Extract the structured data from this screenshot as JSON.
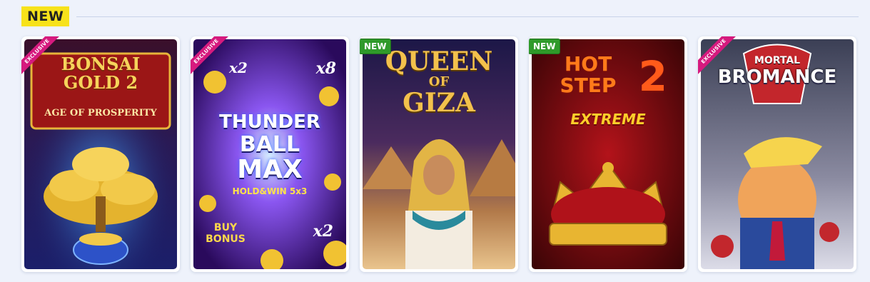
{
  "section": {
    "title": "NEW"
  },
  "games": [
    {
      "title_lines": [
        "BONSAI",
        "GOLD 2"
      ],
      "subtitle": "AGE OF PROSPERITY",
      "tag": "EXCLUSIVE"
    },
    {
      "badges": [
        "x2",
        "x8"
      ],
      "title_lines": [
        "THUNDER",
        "BALL",
        "MAX"
      ],
      "subtitle": "HOLD&WIN 5x3",
      "extra_badge": "x2",
      "buy_lines": [
        "BUY",
        "BONUS"
      ],
      "tag": "EXCLUSIVE"
    },
    {
      "title_lines": [
        "QUEEN",
        "OF",
        "GIZA"
      ],
      "tag": "NEW"
    },
    {
      "title_lines": [
        "HOT",
        "STEP"
      ],
      "number": "2",
      "subtitle": "EXTREME",
      "tag": "NEW"
    },
    {
      "title_lines": [
        "MORTAL",
        "BROMANCE"
      ],
      "tag": "EXCLUSIVE"
    }
  ],
  "colors": {
    "tag_exclusive": "#d61a7e",
    "tag_new": "#2f9a2a",
    "header_bg": "#f7e21a"
  }
}
